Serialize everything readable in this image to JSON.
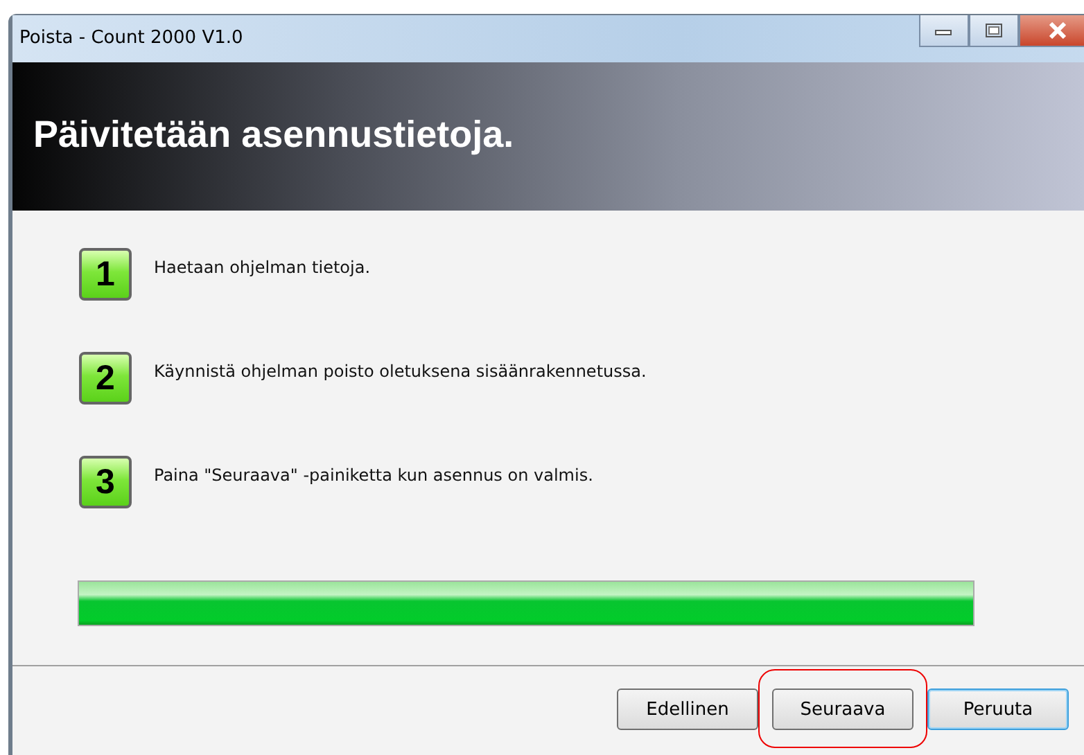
{
  "window": {
    "title": "Poista - Count 2000 V1.0"
  },
  "header": {
    "title": "Päivitetään asennustietoja."
  },
  "steps": [
    {
      "number": "1",
      "text": "Haetaan ohjelman tietoja."
    },
    {
      "number": "2",
      "text": "Käynnistä ohjelman poisto oletuksena sisäänrakennetussa."
    },
    {
      "number": "3",
      "text": "Paina \"Seuraava\" -painiketta kun asennus on valmis."
    }
  ],
  "progress": {
    "level": 1
  },
  "buttons": [
    {
      "label": "Edellinen",
      "default": false,
      "highlighted": false
    },
    {
      "label": "Seuraava",
      "default": false,
      "highlighted": true
    },
    {
      "label": "Peruuta",
      "default": true,
      "highlighted": false
    }
  ]
}
